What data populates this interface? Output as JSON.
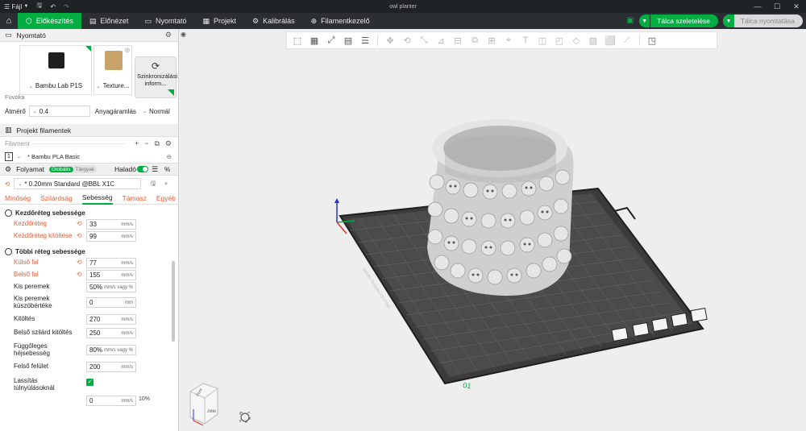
{
  "titlebar": {
    "menu_label": "Fájl",
    "window_title": "owl planter"
  },
  "nav": {
    "tabs": [
      {
        "label": "Előkészítés",
        "icon": "cube-icon"
      },
      {
        "label": "Előnézet",
        "icon": "preview-icon"
      },
      {
        "label": "Nyomtató",
        "icon": "printer-icon"
      },
      {
        "label": "Projekt",
        "icon": "document-icon"
      },
      {
        "label": "Kalibrálás",
        "icon": "calibration-icon"
      },
      {
        "label": "Filamentkezelő",
        "icon": "filament-icon"
      }
    ],
    "slice_label": "Tálca szeletelése",
    "print_label": "Tálca nyomtatása"
  },
  "printer": {
    "section_title": "Nyomtató",
    "printer_name": "Bambu Lab P1S",
    "plate_name": "Texture...",
    "sync_label": "Szinkronizálási inform...",
    "nozzle_header": "Fúvóka",
    "diameter_label": "Átmérő",
    "diameter_value": "0.4",
    "flow_label": "Anyagáramlás",
    "flow_value": "Normál"
  },
  "filaments": {
    "section_title": "Projekt filamentek",
    "filament_label": "Filament",
    "items": [
      {
        "index": "1",
        "name": "* Bambu PLA Basic"
      }
    ]
  },
  "process": {
    "section_title": "Folyamat",
    "scope_global": "Globális",
    "scope_objects": "Tárgyak",
    "advanced_label": "Haladó",
    "preset": "* 0.20mm Standard @BBL X1C",
    "tabs": [
      "Minőség",
      "Szilárdság",
      "Sebesség",
      "Támasz",
      "Egyéb"
    ],
    "active_tab": "Sebesség"
  },
  "speed": {
    "group1_title": "Kezdőréteg sebessége",
    "group1": [
      {
        "label": "Kezdőréteg",
        "value": "33",
        "unit": "mm/s",
        "modified": true
      },
      {
        "label": "Kezdőréteg kitöltése",
        "value": "99",
        "unit": "mm/s",
        "modified": true
      }
    ],
    "group2_title": "Többi réteg sebessége",
    "group2": [
      {
        "label": "Külső fal",
        "value": "77",
        "unit": "mm/s",
        "modified": true
      },
      {
        "label": "Belső fal",
        "value": "155",
        "unit": "mm/s",
        "modified": true
      },
      {
        "label": "Kis peremek",
        "value": "50%",
        "unit": "mm/s vagy %",
        "modified": false
      },
      {
        "label": "Kis peremek küszöbértéke",
        "value": "0",
        "unit": "mm",
        "modified": false
      },
      {
        "label": "Kitöltés",
        "value": "270",
        "unit": "mm/s",
        "modified": false
      },
      {
        "label": "Belső szilárd kitöltés",
        "value": "250",
        "unit": "mm/s",
        "modified": false
      },
      {
        "label": "Függőleges héjsebesség",
        "value": "80%",
        "unit": "mm/s vagy %",
        "modified": false
      },
      {
        "label": "Felső felület",
        "value": "200",
        "unit": "mm/s",
        "modified": false
      }
    ],
    "overhang_label": "Lassítás túlnyúlásoknál",
    "overhang_row": {
      "value": "0",
      "unit": "mm/s",
      "extra": "10%"
    }
  },
  "viewport": {
    "plate_label": "Bambu Textured PEI Plate",
    "plate_number": "01",
    "cube_top": "Fent",
    "cube_right": "Jobb",
    "colors": {
      "accent": "#00ae42",
      "modified": "#e35f38",
      "bed": "#3a3a3a",
      "model": "#d8d8d8"
    }
  }
}
